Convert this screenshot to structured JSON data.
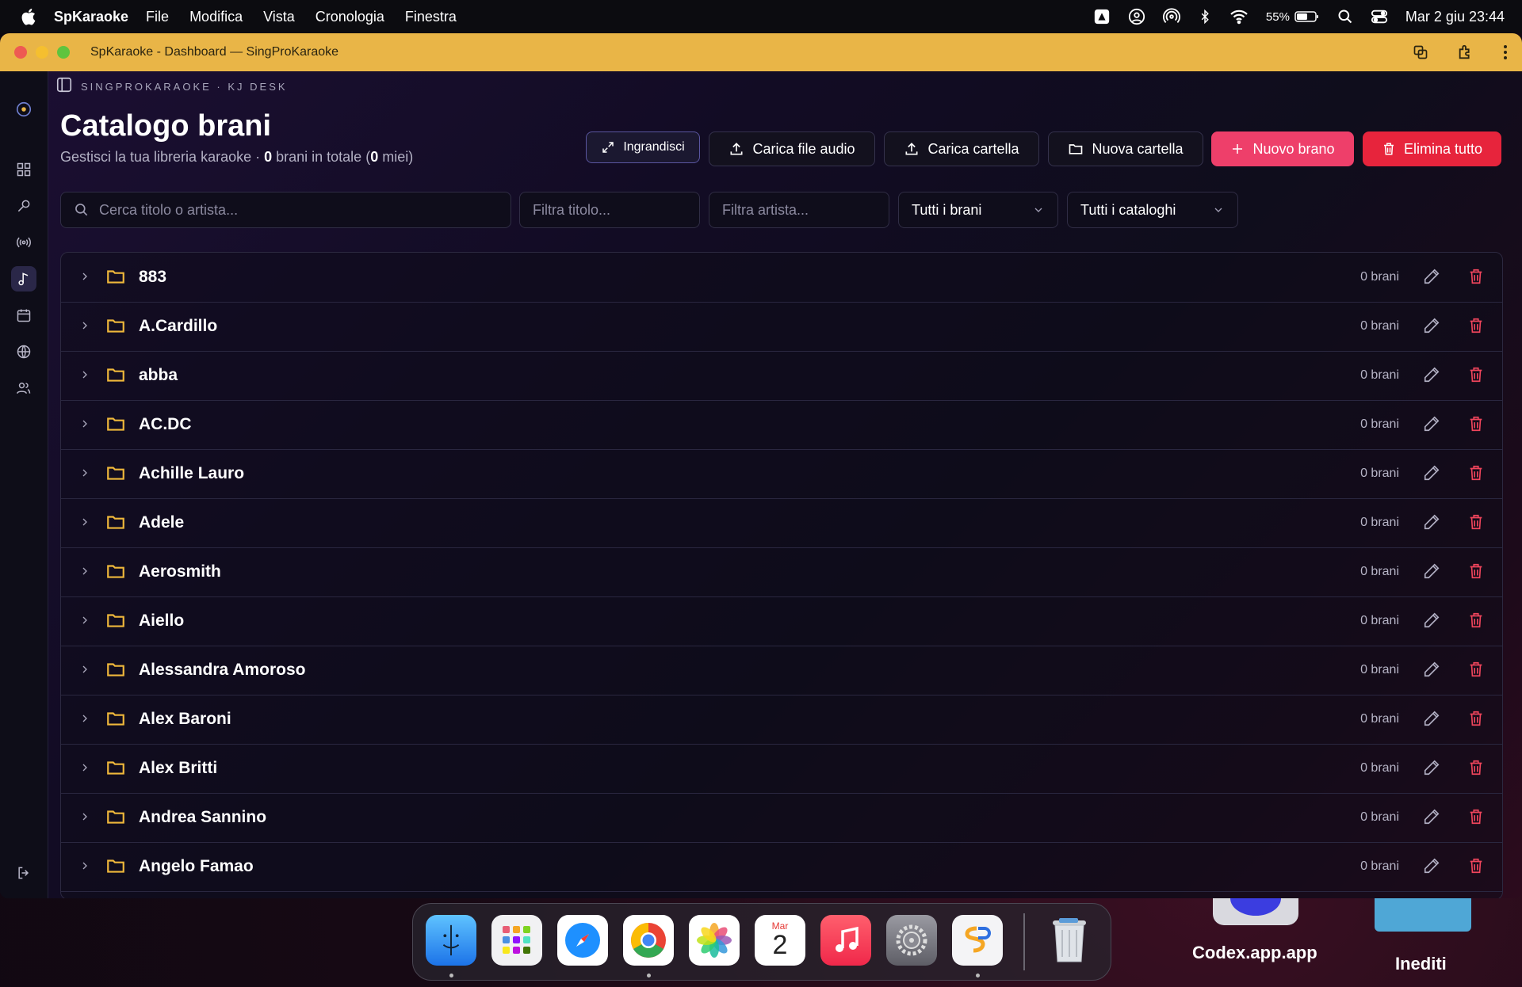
{
  "menubar": {
    "app_name": "SpKaraoke",
    "menus": [
      "File",
      "Modifica",
      "Vista",
      "Cronologia",
      "Finestra"
    ],
    "battery": "55%",
    "datetime": "Mar 2 giu  23:44"
  },
  "window": {
    "title": "SpKaraoke - Dashboard — SingProKaraoke"
  },
  "app": {
    "brand": "SINGPROKARAOKE · KJ DESK",
    "page_title": "Catalogo brani",
    "subtitle_prefix": "Gestisci la tua libreria karaoke · ",
    "total_count": "0",
    "subtitle_mid": " brani in totale (",
    "mine_count": "0",
    "subtitle_suffix": " miei)"
  },
  "toolbar": {
    "expand_label": "Ingrandisci",
    "upload_audio_label": "Carica file audio",
    "upload_folder_label": "Carica cartella",
    "new_folder_label": "Nuova cartella",
    "new_song_label": "Nuovo brano",
    "delete_all_label": "Elimina tutto"
  },
  "filters": {
    "search_placeholder": "Cerca titolo o artista...",
    "title_placeholder": "Filtra titolo...",
    "artist_placeholder": "Filtra artista...",
    "songs_select": "Tutti i brani",
    "catalog_select": "Tutti i cataloghi"
  },
  "folders": [
    {
      "name": "883",
      "count": "0 brani"
    },
    {
      "name": "A.Cardillo",
      "count": "0 brani"
    },
    {
      "name": "abba",
      "count": "0 brani"
    },
    {
      "name": "AC.DC",
      "count": "0 brani"
    },
    {
      "name": "Achille Lauro",
      "count": "0 brani"
    },
    {
      "name": "Adele",
      "count": "0 brani"
    },
    {
      "name": "Aerosmith",
      "count": "0 brani"
    },
    {
      "name": "Aiello",
      "count": "0 brani"
    },
    {
      "name": "Alessandra Amoroso",
      "count": "0 brani"
    },
    {
      "name": "Alex Baroni",
      "count": "0 brani"
    },
    {
      "name": "Alex Britti",
      "count": "0 brani"
    },
    {
      "name": "Andrea Sannino",
      "count": "0 brani"
    },
    {
      "name": "Angelo Famao",
      "count": "0 brani"
    }
  ],
  "dock": {
    "calendar_month": "Mar",
    "calendar_day": "2"
  },
  "desktop": {
    "codex_label": "Codex.app.app",
    "folder_label": "Inediti"
  },
  "colors": {
    "accent_pink": "#ee3f6a",
    "danger_red": "#e7243c",
    "folder_yellow": "#efb83b",
    "titlebar": "#e9b547"
  }
}
